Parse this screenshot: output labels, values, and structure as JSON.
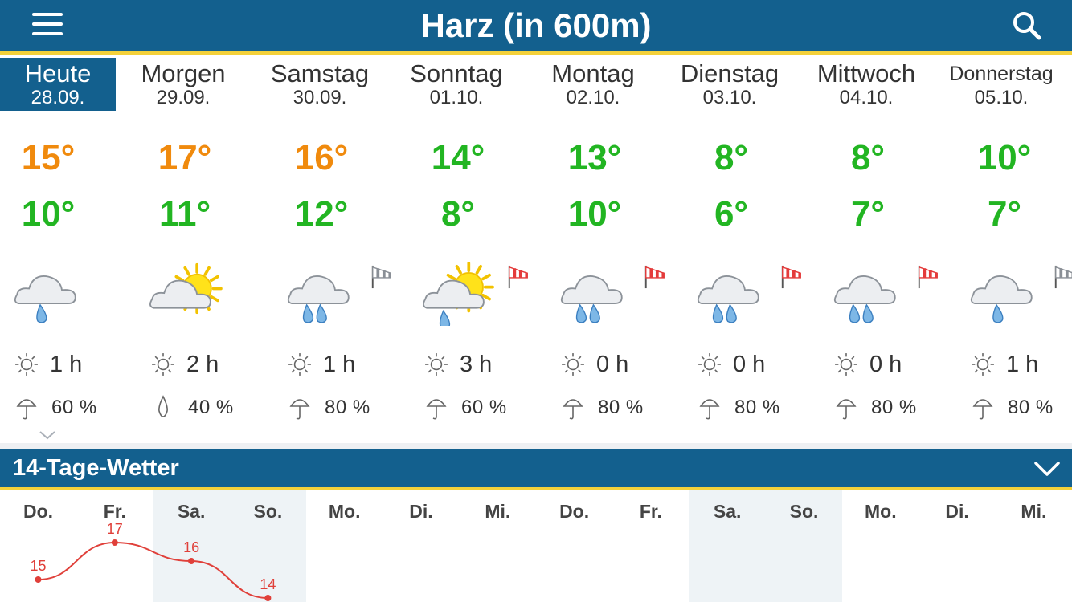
{
  "header": {
    "title": "Harz (in 600m)"
  },
  "days": [
    {
      "name": "Heute",
      "date": "28.09.",
      "max": "15°",
      "min": "10°",
      "max_color": "orange",
      "weather": "rain-cloud",
      "wind": null,
      "sun": "1 h",
      "rain": "60 %",
      "rain_icon": "umbrella-icon"
    },
    {
      "name": "Morgen",
      "date": "29.09.",
      "max": "17°",
      "min": "11°",
      "max_color": "orange",
      "weather": "sun-cloud",
      "wind": null,
      "sun": "2 h",
      "rain": "40 %",
      "rain_icon": "drop-icon"
    },
    {
      "name": "Samstag",
      "date": "30.09.",
      "max": "16°",
      "min": "12°",
      "max_color": "orange",
      "weather": "heavy-rain-cloud",
      "wind": "grey",
      "sun": "1 h",
      "rain": "80 %",
      "rain_icon": "umbrella-icon"
    },
    {
      "name": "Sonntag",
      "date": "01.10.",
      "max": "14°",
      "min": "8°",
      "max_color": "green",
      "weather": "sun-rain-cloud",
      "wind": "red",
      "sun": "3 h",
      "rain": "60 %",
      "rain_icon": "umbrella-icon"
    },
    {
      "name": "Montag",
      "date": "02.10.",
      "max": "13°",
      "min": "10°",
      "max_color": "green",
      "weather": "heavy-rain-cloud",
      "wind": "red",
      "sun": "0 h",
      "rain": "80 %",
      "rain_icon": "umbrella-icon"
    },
    {
      "name": "Dienstag",
      "date": "03.10.",
      "max": "8°",
      "min": "6°",
      "max_color": "green",
      "weather": "heavy-rain-cloud",
      "wind": "red",
      "sun": "0 h",
      "rain": "80 %",
      "rain_icon": "umbrella-icon"
    },
    {
      "name": "Mittwoch",
      "date": "04.10.",
      "max": "8°",
      "min": "7°",
      "max_color": "green",
      "weather": "heavy-rain-cloud",
      "wind": "red",
      "sun": "0 h",
      "rain": "80 %",
      "rain_icon": "umbrella-icon"
    },
    {
      "name": "Donnerstag",
      "date": "05.10.",
      "max": "10°",
      "min": "7°",
      "max_color": "green",
      "weather": "rain-cloud",
      "wind": "grey",
      "sun": "1 h",
      "rain": "80 %",
      "rain_icon": "umbrella-icon"
    }
  ],
  "section14": {
    "title": "14-Tage-Wetter",
    "days": [
      "Do.",
      "Fr.",
      "Sa.",
      "So.",
      "Mo.",
      "Di.",
      "Mi.",
      "Do.",
      "Fr.",
      "Sa.",
      "So.",
      "Mo.",
      "Di.",
      "Mi."
    ],
    "weekend": [
      false,
      false,
      true,
      true,
      false,
      false,
      false,
      false,
      false,
      true,
      true,
      false,
      false,
      false
    ]
  },
  "chart_data": {
    "type": "line",
    "x": [
      "Do.",
      "Fr.",
      "Sa.",
      "So."
    ],
    "series": [
      {
        "values": [
          15,
          17,
          16,
          14
        ]
      }
    ],
    "labels": [
      "15",
      "17",
      "16",
      "14"
    ]
  },
  "colors": {
    "bar": "#13608e",
    "accent": "#f4d13a",
    "orange": "#f08a0d",
    "green": "#22b522",
    "chart_line": "#e0403a"
  }
}
